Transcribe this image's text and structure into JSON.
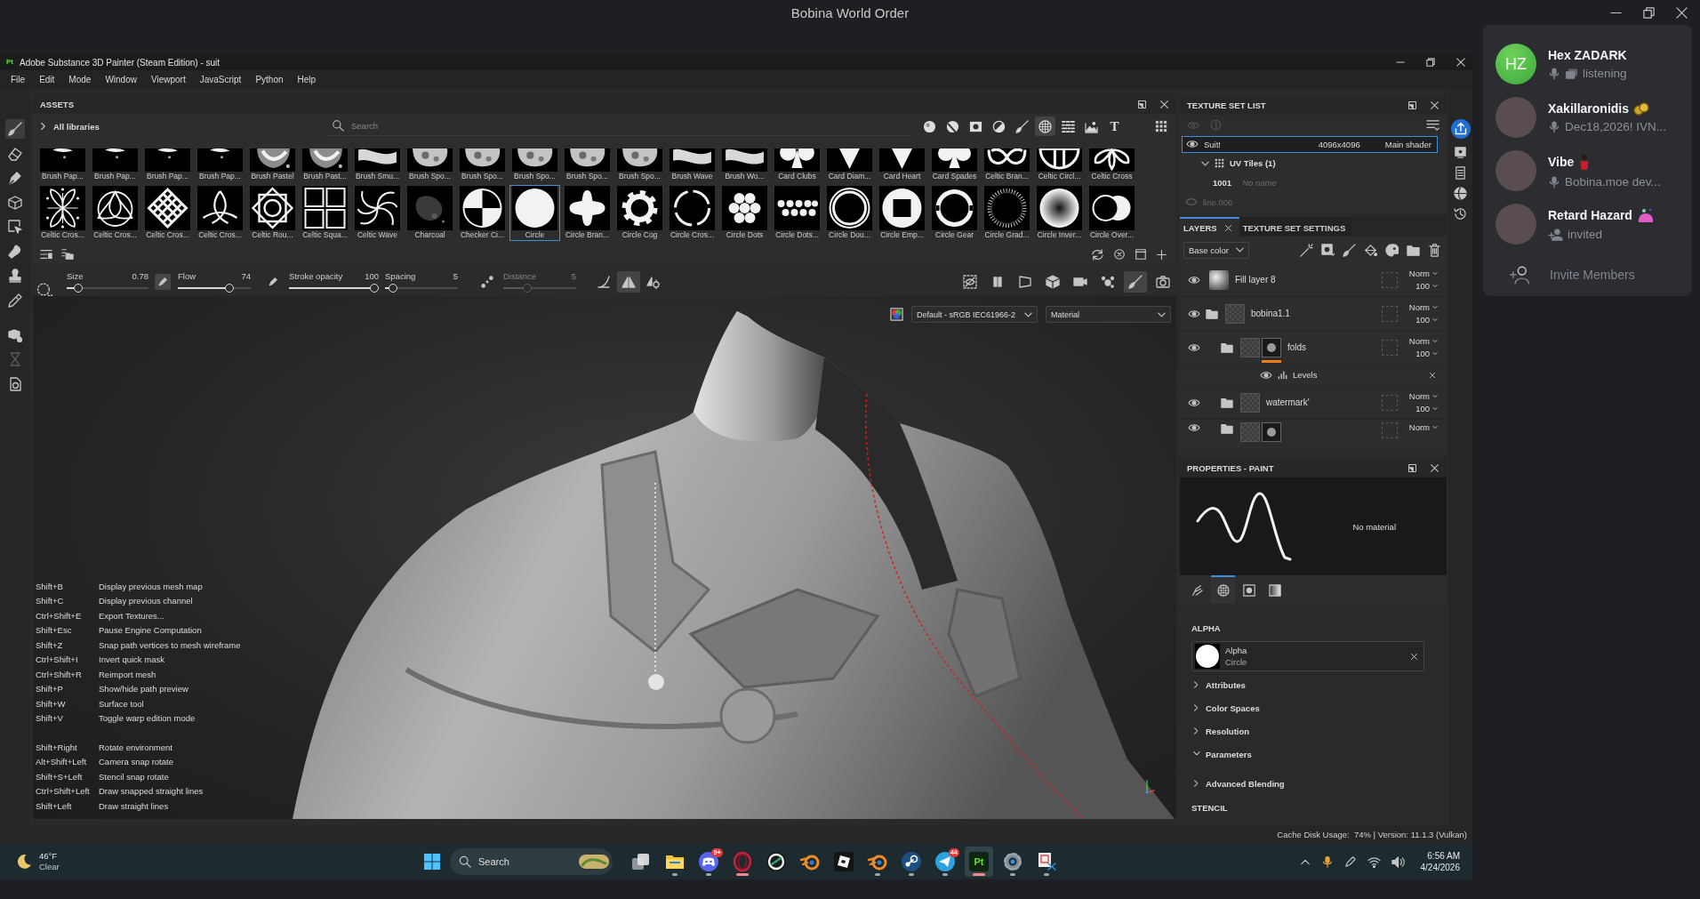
{
  "window": {
    "title": "Bobina World Order"
  },
  "app": {
    "logo": "Pt",
    "title": "Adobe Substance 3D Painter (Steam Edition) - suit"
  },
  "menu": [
    "File",
    "Edit",
    "Mode",
    "Window",
    "Viewport",
    "JavaScript",
    "Python",
    "Help"
  ],
  "tools": [
    {
      "kind": "brush",
      "selected": true,
      "disabled": false
    },
    {
      "kind": "eraser",
      "selected": false,
      "disabled": false
    },
    {
      "kind": "pen",
      "selected": false,
      "disabled": false
    },
    {
      "kind": "cube",
      "selected": false,
      "disabled": false
    },
    {
      "kind": "select",
      "selected": false,
      "disabled": false
    },
    {
      "kind": "smudge",
      "selected": false,
      "disabled": false
    },
    {
      "kind": "stamp",
      "selected": false,
      "disabled": false
    },
    {
      "kind": "picker",
      "selected": false,
      "disabled": false
    },
    {
      "kind": "bake",
      "selected": false,
      "disabled": false
    },
    {
      "kind": "timer",
      "selected": false,
      "disabled": true
    },
    {
      "kind": "doc",
      "selected": false,
      "disabled": false
    }
  ],
  "assets": {
    "title": "ASSETS",
    "library": "All libraries",
    "search": {
      "placeholder": "Search"
    },
    "filters": [
      {
        "kind": "sphere",
        "selected": false
      },
      {
        "kind": "striped-sphere",
        "selected": false
      },
      {
        "kind": "square-dot",
        "selected": false
      },
      {
        "kind": "half-circle",
        "selected": false
      },
      {
        "kind": "brush",
        "selected": false
      },
      {
        "kind": "hatched",
        "selected": true
      },
      {
        "kind": "noise",
        "selected": false
      },
      {
        "kind": "landscape",
        "selected": false
      },
      {
        "kind": "font",
        "glyph": "T",
        "selected": false
      }
    ],
    "rows": [
      [
        {
          "label": "Brush Pap...",
          "kind": "speck",
          "selected": false
        },
        {
          "label": "Brush Pap...",
          "kind": "speck",
          "selected": false
        },
        {
          "label": "Brush Pap...",
          "kind": "speck",
          "selected": false
        },
        {
          "label": "Brush Pap...",
          "kind": "speck",
          "selected": false
        },
        {
          "label": "Brush Pastel",
          "kind": "grain",
          "selected": false
        },
        {
          "label": "Brush Past...",
          "kind": "grain",
          "selected": false
        },
        {
          "label": "Brush Smu...",
          "kind": "smudge",
          "selected": false
        },
        {
          "label": "Brush Spo...",
          "kind": "blot",
          "selected": false
        },
        {
          "label": "Brush Spo...",
          "kind": "blot",
          "selected": false
        },
        {
          "label": "Brush Spo...",
          "kind": "blot",
          "selected": false
        },
        {
          "label": "Brush Spo...",
          "kind": "blot",
          "selected": false
        },
        {
          "label": "Brush Spo...",
          "kind": "blot",
          "selected": false
        },
        {
          "label": "Brush Wave",
          "kind": "smudge",
          "selected": false
        },
        {
          "label": "Brush Wo...",
          "kind": "smudge",
          "selected": false
        },
        {
          "label": "Card Clubs",
          "kind": "club",
          "selected": false
        },
        {
          "label": "Card Diam...",
          "kind": "triangle",
          "selected": false
        },
        {
          "label": "Card Heart",
          "kind": "triangle",
          "selected": false
        },
        {
          "label": "Card Spades",
          "kind": "spade",
          "selected": false
        },
        {
          "label": "Celtic Bran...",
          "kind": "knot",
          "selected": false
        },
        {
          "label": "Celtic Circl...",
          "kind": "half-ring",
          "selected": false
        },
        {
          "label": "Celtic Cross",
          "kind": "petals",
          "selected": false
        }
      ],
      [
        {
          "label": "Celtic Cros...",
          "kind": "quatrefoil",
          "selected": false
        },
        {
          "label": "Celtic Cros...",
          "kind": "triquetra",
          "selected": false
        },
        {
          "label": "Celtic Cros...",
          "kind": "lattice",
          "selected": false
        },
        {
          "label": "Celtic Cros...",
          "kind": "triskele",
          "selected": false
        },
        {
          "label": "Celtic Rou...",
          "kind": "rosette",
          "selected": false
        },
        {
          "label": "Celtic Squa...",
          "kind": "squares",
          "selected": false
        },
        {
          "label": "Celtic Wave",
          "kind": "swirl",
          "selected": false
        },
        {
          "label": "Charcoal",
          "kind": "charcoal",
          "selected": false
        },
        {
          "label": "Checker Ci...",
          "kind": "checker",
          "selected": false
        },
        {
          "label": "Circle",
          "kind": "circle",
          "selected": true
        },
        {
          "label": "Circle Bran...",
          "kind": "blob-cross",
          "selected": false
        },
        {
          "label": "Circle Cog",
          "kind": "cog",
          "selected": false
        },
        {
          "label": "Circle Cros...",
          "kind": "dashed-ring",
          "selected": false
        },
        {
          "label": "Circle Dots",
          "kind": "dots",
          "selected": false
        },
        {
          "label": "Circle Dots...",
          "kind": "dot-rows",
          "selected": false
        },
        {
          "label": "Circle Dou...",
          "kind": "double-ring",
          "selected": false
        },
        {
          "label": "Circle Emp...",
          "kind": "square-hole",
          "selected": false
        },
        {
          "label": "Circle Gear",
          "kind": "gear-ring",
          "selected": false
        },
        {
          "label": "Circle Grad...",
          "kind": "sunburst",
          "selected": false
        },
        {
          "label": "Circle Inver...",
          "kind": "gradient",
          "selected": false
        },
        {
          "label": "Circle Over...",
          "kind": "overlap",
          "selected": false
        }
      ]
    ]
  },
  "brush_settings": {
    "sliders": [
      {
        "kind": "shape",
        "label": "Size",
        "reading": "0.78",
        "level": 0.1,
        "disabled": false
      },
      {
        "kind": "pressure",
        "on": true,
        "label": "Flow",
        "reading": "74",
        "level": 0.74,
        "disabled": false
      },
      {
        "kind": "pressure",
        "on": false,
        "label": "Stroke opacity",
        "reading": "100",
        "level": 1,
        "disabled": false
      },
      {
        "kind": "plain",
        "label": "Spacing",
        "reading": "5",
        "level": 0.06,
        "disabled": false
      },
      {
        "kind": "lazy",
        "label": "Distance",
        "reading": "5",
        "level": 0.3,
        "disabled": true
      }
    ],
    "tools": [
      {
        "kind": "curve",
        "selected": false
      },
      {
        "kind": "symmetry",
        "selected": true
      },
      {
        "kind": "symmetry-settings",
        "selected": false
      }
    ]
  },
  "view_tools": [
    {
      "kind": "hide",
      "selected": false
    },
    {
      "kind": "pause",
      "selected": false
    },
    {
      "kind": "perspective",
      "selected": false
    },
    {
      "kind": "cube",
      "selected": false
    },
    {
      "kind": "camera",
      "selected": false
    },
    {
      "kind": "splash",
      "selected": false
    },
    {
      "kind": "paint",
      "selected": true
    },
    {
      "kind": "screenshot",
      "selected": false
    }
  ],
  "viewport": {
    "colorspace": "Default - sRGB IEC61966-2",
    "mode": "Material",
    "shortcut_groups": [
      [
        {
          "keys": "Shift+B",
          "action": "Display previous mesh map"
        },
        {
          "keys": "Shift+C",
          "action": "Display previous channel"
        },
        {
          "keys": "Ctrl+Shift+E",
          "action": "Export Textures..."
        },
        {
          "keys": "Shift+Esc",
          "action": "Pause Engine Computation"
        },
        {
          "keys": "Shift+Z",
          "action": "Snap path vertices to mesh wireframe"
        },
        {
          "keys": "Ctrl+Shift+I",
          "action": "Invert quick mask"
        },
        {
          "keys": "Ctrl+Shift+R",
          "action": "Reimport mesh"
        },
        {
          "keys": "Shift+P",
          "action": "Show/hide path preview"
        },
        {
          "keys": "Shift+W",
          "action": "Surface tool"
        },
        {
          "keys": "Shift+V",
          "action": "Toggle warp edition mode"
        }
      ],
      [
        {
          "keys": "Shift+Right",
          "action": "Rotate environment"
        },
        {
          "keys": "Alt+Shift+Left",
          "action": "Camera snap rotate"
        },
        {
          "keys": "Shift+S+Left",
          "action": "Stencil snap rotate"
        },
        {
          "keys": "Ctrl+Shift+Left",
          "action": "Draw snapped straight lines"
        },
        {
          "keys": "Shift+Left",
          "action": "Draw straight lines"
        }
      ]
    ]
  },
  "texture_set_list": {
    "title": "TEXTURE SET LIST",
    "sets": [
      {
        "name": "Suit!",
        "resolution": "4096x4096",
        "shader": "Main shader",
        "selected": true,
        "visible": true,
        "uv_tiles": {
          "label": "UV Tiles (1)",
          "expanded": true,
          "tiles": [
            {
              "id": "1001",
              "name": "No name"
            }
          ]
        }
      },
      {
        "name": "line.006",
        "selected": false,
        "visible": false
      }
    ]
  },
  "layers": {
    "tabs": [
      {
        "label": "LAYERS",
        "selected": true,
        "closable": true
      },
      {
        "label": "TEXTURE SET SETTINGS",
        "selected": false,
        "closable": false
      }
    ],
    "channel": "Base color",
    "items": [
      {
        "kind": "fill",
        "name": "Fill layer 8",
        "visible": true,
        "blend": "Norm",
        "opacity": "100"
      },
      {
        "kind": "folder",
        "name": "bobina1.1",
        "visible": true,
        "blend": "Norm",
        "opacity": "100",
        "children": [
          {
            "kind": "folder",
            "name": "folds",
            "visible": true,
            "blend": "Norm",
            "opacity": "100",
            "mask": true,
            "mask_active": true,
            "children": [
              {
                "kind": "effect",
                "name": "Levels",
                "visible": true
              }
            ]
          },
          {
            "kind": "folder",
            "name": "watermark'",
            "visible": true,
            "blend": "Norm",
            "opacity": "100"
          },
          {
            "kind": "folder",
            "visible": true,
            "blend": "Norm",
            "mask": true,
            "mask_active": false
          }
        ]
      }
    ]
  },
  "properties": {
    "title": "PROPERTIES - PAINT",
    "preview_label": "No material",
    "tabs": [
      {
        "kind": "brush",
        "selected": false
      },
      {
        "kind": "alpha",
        "selected": true
      },
      {
        "kind": "stencil",
        "selected": false
      },
      {
        "kind": "material",
        "selected": false
      }
    ],
    "section": "ALPHA",
    "alpha": {
      "label": "Alpha",
      "name": "Circle"
    },
    "groups": [
      {
        "label": "Attributes",
        "expanded": false
      },
      {
        "label": "Color Spaces",
        "expanded": false
      },
      {
        "label": "Resolution",
        "expanded": false
      },
      {
        "label": "Parameters",
        "expanded": true
      },
      {
        "label": "Advanced Blending",
        "expanded": false
      }
    ],
    "next_section": "STENCIL"
  },
  "status_bar": {
    "text": "Cache Disk Usage:  74% | Version: 11.1.3 (Vulkan)"
  },
  "taskbar": {
    "weather": {
      "temperature": "46°F",
      "condition": "Clear"
    },
    "search": {
      "placeholder": "Search"
    },
    "apps": [
      {
        "kind": "tasks",
        "running": false,
        "attention": false,
        "focused": false
      },
      {
        "kind": "files",
        "running": true,
        "attention": false,
        "focused": false
      },
      {
        "kind": "chat",
        "badge": "9+",
        "running": true,
        "attention": false,
        "focused": false
      },
      {
        "kind": "browser",
        "running": true,
        "attention": true,
        "focused": false
      },
      {
        "kind": "slash",
        "running": false,
        "attention": false,
        "focused": false
      },
      {
        "kind": "orbit",
        "running": false,
        "attention": false,
        "focused": false
      },
      {
        "kind": "blocks",
        "running": false,
        "attention": false,
        "focused": false
      },
      {
        "kind": "orbit",
        "running": true,
        "attention": false,
        "focused": false
      },
      {
        "kind": "games",
        "running": true,
        "attention": false,
        "focused": false
      },
      {
        "kind": "messenger",
        "badge": "44",
        "running": true,
        "attention": false,
        "focused": false
      },
      {
        "kind": "painter",
        "label": "Pt",
        "running": true,
        "attention": true,
        "focused": true
      },
      {
        "kind": "settings",
        "running": true,
        "attention": false,
        "focused": false
      },
      {
        "kind": "capture",
        "running": true,
        "attention": false,
        "focused": false
      }
    ],
    "clock": {
      "time": "6:56 AM",
      "date": "4/24/2026"
    }
  },
  "voice_overlay": {
    "members": [
      {
        "kind": "voice",
        "initials": "HZ",
        "name": "Hex ZADARK",
        "streaming": true,
        "status": "listening"
      },
      {
        "kind": "voice",
        "name": "Xakillaronidis",
        "badge": {
          "kind": "coins"
        },
        "streaming": false,
        "status": "Dec18,2026! IVN..."
      },
      {
        "kind": "voice",
        "name": "Vibe",
        "badge": {
          "kind": "figure"
        },
        "streaming": false,
        "status": "Bobina.moe dev..."
      },
      {
        "kind": "invited",
        "name": "Retard Hazard",
        "badge": {
          "kind": "slime"
        },
        "streaming": false,
        "status": "invited"
      }
    ],
    "invite": "Invite Members"
  }
}
